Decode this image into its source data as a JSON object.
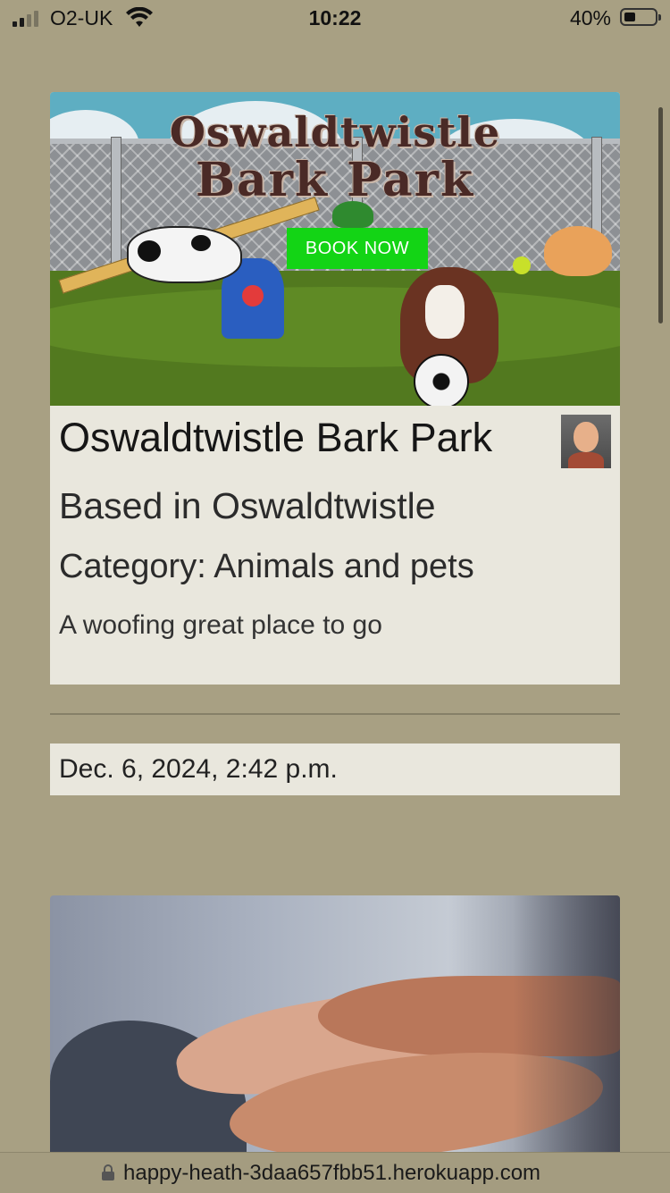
{
  "status_bar": {
    "carrier": "O2-UK",
    "time": "10:22",
    "battery_percent": "40%",
    "battery_level": 0.4,
    "signal_bars": 2
  },
  "card": {
    "hero": {
      "title_line1": "Oswaldtwistle",
      "title_line2": "Bark Park",
      "button_label": "BOOK NOW"
    },
    "title": "Oswaldtwistle Bark Park",
    "location": "Based in Oswaldtwistle",
    "category": "Category: Animals and pets",
    "description": "A woofing great place to go",
    "avatar_icon": "user-avatar"
  },
  "posted_date": "Dec. 6, 2024, 2:42 p.m.",
  "url_bar": {
    "url": "happy-heath-3daa657fbb51.herokuapp.com",
    "icon": "lock-icon"
  },
  "colors": {
    "background": "#a8a083",
    "card": "#e9e7dd",
    "book_now": "#13d415"
  }
}
